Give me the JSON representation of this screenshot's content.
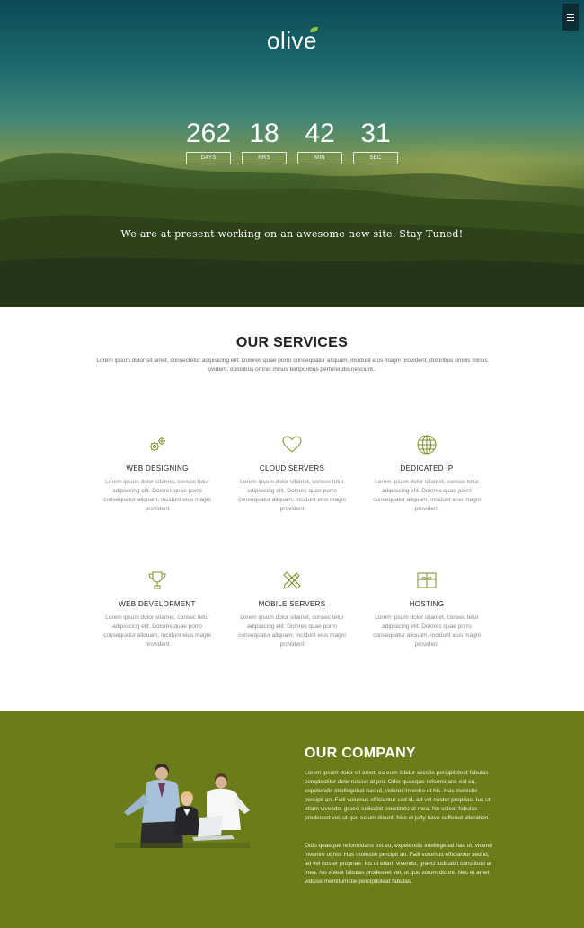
{
  "logo": {
    "text": "olive"
  },
  "menu": {
    "icon": "hamburger-icon"
  },
  "countdown": [
    {
      "value": "262",
      "label": "DAYS"
    },
    {
      "value": "18",
      "label": "HRS"
    },
    {
      "value": "42",
      "label": "MIN"
    },
    {
      "value": "31",
      "label": "SEC"
    }
  ],
  "hero": {
    "tagline": "We are at present working on an awesome new site. Stay Tuned!"
  },
  "services": {
    "title": "OUR SERVICES",
    "intro": "Lorem ipsum dolor sit amet, consectetur adipisicing elit. Dolores quae porro consequatur aliquam, incidunt eius magni provident, doloribus omnis minus ovident, doloribus omnis minus temporibus perferendis nesciunt..",
    "items": [
      {
        "name": "WEB DESIGNING",
        "icon": "gears-icon",
        "desc": "Lorem ipsum dolor sitamet, consec tetur adipisicing elit. Dolores quae porro consequatur aliquam, incidunt eius magni provident"
      },
      {
        "name": "CLOUD SERVERS",
        "icon": "heart-icon",
        "desc": "Lorem ipsum dolor sitamet, consec tetur adipisicing elit. Dolores quae porro consequatur aliquam, incidunt eius magni provident"
      },
      {
        "name": "DEDICATED IP",
        "icon": "globe-icon",
        "desc": "Lorem ipsum dolor sitamet, consec tetur adipisicing elit. Dolores quae porro consequatur aliquam, incidunt eius magni provident"
      },
      {
        "name": "WEB DEVELOPMENT",
        "icon": "trophy-icon",
        "desc": "Lorem ipsum dolor sitamet, consec tetur adipisicing elit. Dolores quae porro consequatur aliquam, incidunt eius magni provident"
      },
      {
        "name": "MOBILE SERVERS",
        "icon": "pencil-ruler-icon",
        "desc": "Lorem ipsum dolor sitamet, consec tetur adipisicing elit. Dolores quae porro consequatur aliquam, incidunt eius magni provident"
      },
      {
        "name": "HOSTING",
        "icon": "gift-icon",
        "desc": "Lorem ipsum dolor sitamet, consec tetur adipisicing elit. Dolores quae porro consequatur aliquam, incidunt eius magni provident"
      }
    ]
  },
  "company": {
    "title": "OUR COMPANY",
    "p1": "Lorem ipsum dolor sit amet, ea eum labitur scsstie percipitoleat fabulas complectitur deterruisset at pro. Odio quaeque reformidans est eu, expetendis intellegebat has ut, viderer invenire ut his. Has molestie percipit an. Falli volumus efficiantur sed id, ad vel noster propriae. Ius ut etiam vivendo, graeci iudicabit constituto at mea. No soleat fabulas prodesset vel, ut quo solum dicunt. Nec et jufty have suffered alteration.",
    "p2": "Odio quaeque reformidans est eu, expetendis intellegebat has ut, viderer invenire ut his. Has molestie percipit an. Falli volumus efficiantur sed id, ad vel noster propriae. Ius ut etiam vivendo, graeci iudicabit constituto at mea. No soleat fabulas prodesset vel, ut quo solum dicunt. Nec et amet vidisse mentitumstie percipitoleat fabulas."
  },
  "colors": {
    "accent": "#6b7d1a",
    "icon": "#7d8f2a"
  }
}
